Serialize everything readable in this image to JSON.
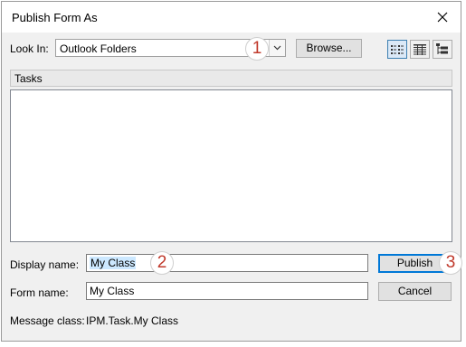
{
  "window": {
    "title": "Publish Form As"
  },
  "look_in": {
    "label": "Look In:",
    "value": "Outlook Folders"
  },
  "buttons": {
    "browse": "Browse...",
    "publish": "Publish",
    "cancel": "Cancel"
  },
  "list": {
    "header": "Tasks"
  },
  "display_name": {
    "label": "Display name:",
    "value": "My Class"
  },
  "form_name": {
    "label": "Form name:",
    "value": "My Class"
  },
  "message_class": {
    "label": "Message class:",
    "value": "IPM.Task.My Class"
  },
  "callouts": [
    "1",
    "2",
    "3"
  ],
  "icons": [
    "close-icon",
    "chevron-down-icon",
    "list-view-icon",
    "details-view-icon",
    "tree-view-icon"
  ],
  "colors": {
    "callout_text": "#c0392b",
    "default_button_border": "#0078d7",
    "selection": "#cce8ff"
  }
}
